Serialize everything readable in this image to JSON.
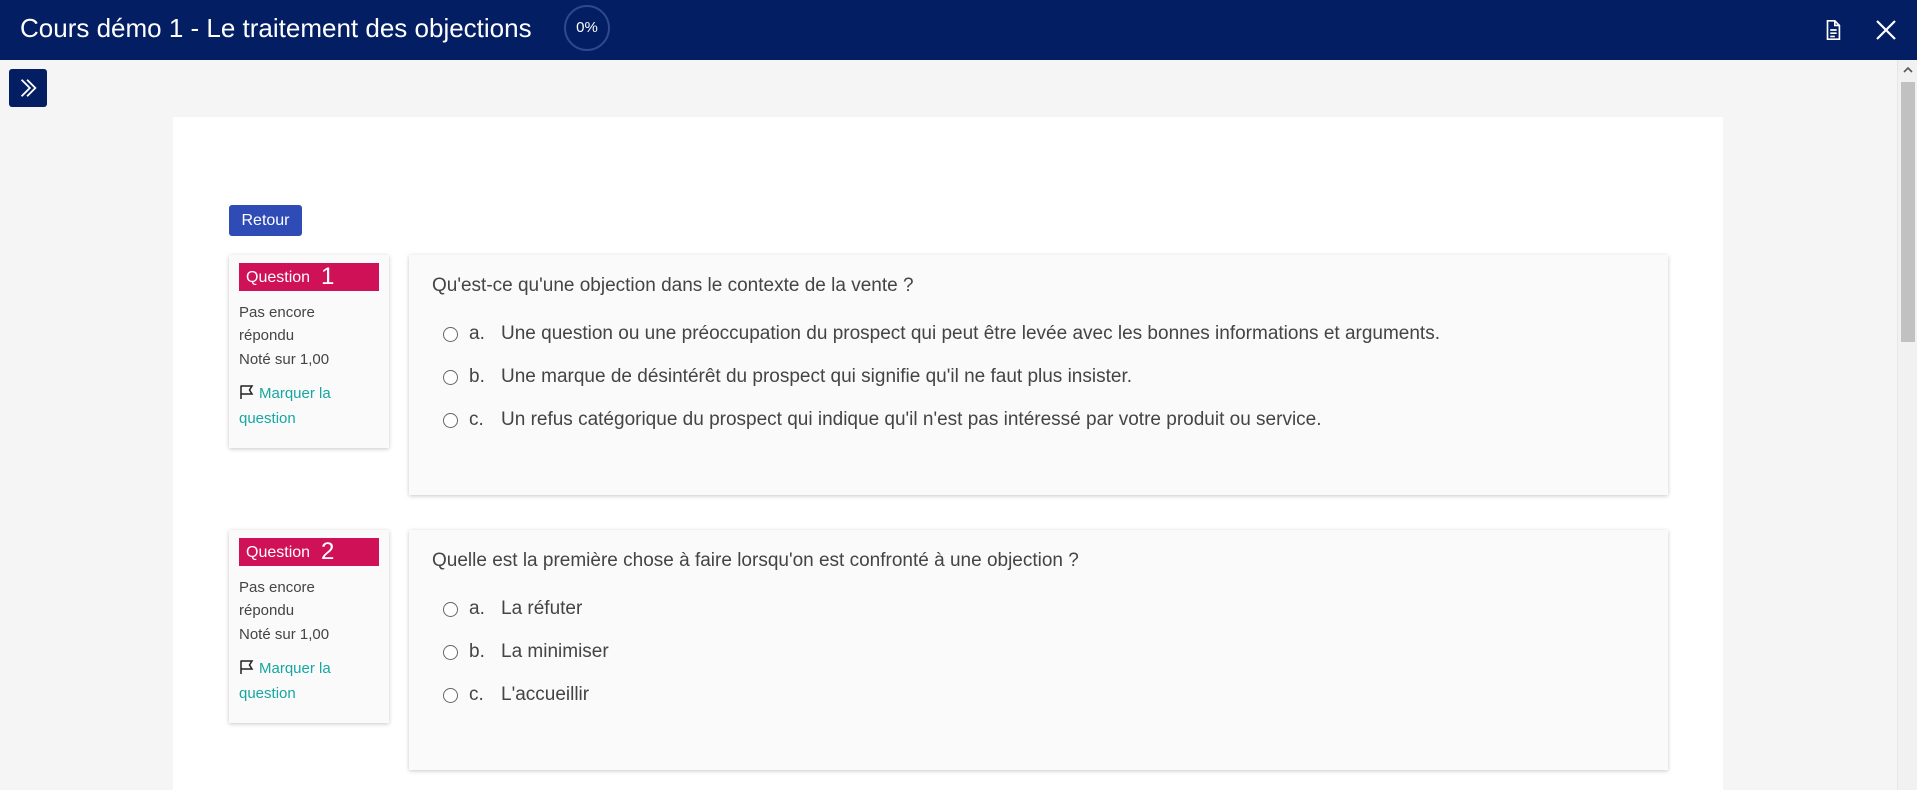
{
  "header": {
    "course_title": "Cours démo 1 - Le traitement des objections",
    "progress_label": "0%",
    "progress_value": 0,
    "icons": [
      "document-icon",
      "close-icon"
    ]
  },
  "sidebar_toggle": {
    "icon": "double-chevron-right-icon"
  },
  "back_button": {
    "label": "Retour"
  },
  "colors": {
    "header_bg": "#031e63",
    "question_badge": "#cf1158",
    "button_blue": "#2f4bb5",
    "link_teal": "#16a7a2"
  },
  "questions": [
    {
      "label": "Question",
      "number": "1",
      "status": "Pas encore répondu",
      "grade": "Noté sur 1,00",
      "flag_label": "Marquer la question",
      "text": "Qu'est-ce qu'une objection dans le contexte de la vente ?",
      "options": [
        {
          "letter": "a.",
          "text": "Une question ou une préoccupation du prospect qui peut être levée avec les bonnes informations et arguments."
        },
        {
          "letter": "b.",
          "text": "Une marque de désintérêt du prospect qui signifie qu'il ne faut plus insister."
        },
        {
          "letter": "c.",
          "text": "Un refus catégorique du prospect qui indique qu'il n'est pas intéressé par votre produit ou service."
        }
      ]
    },
    {
      "label": "Question",
      "number": "2",
      "status": "Pas encore répondu",
      "grade": "Noté sur 1,00",
      "flag_label": "Marquer la question",
      "text": "Quelle est la première chose à faire lorsqu'on est confronté à une objection ?",
      "options": [
        {
          "letter": "a.",
          "text": "La réfuter"
        },
        {
          "letter": "b.",
          "text": "La minimiser"
        },
        {
          "letter": "c.",
          "text": "L'accueillir"
        }
      ]
    }
  ]
}
